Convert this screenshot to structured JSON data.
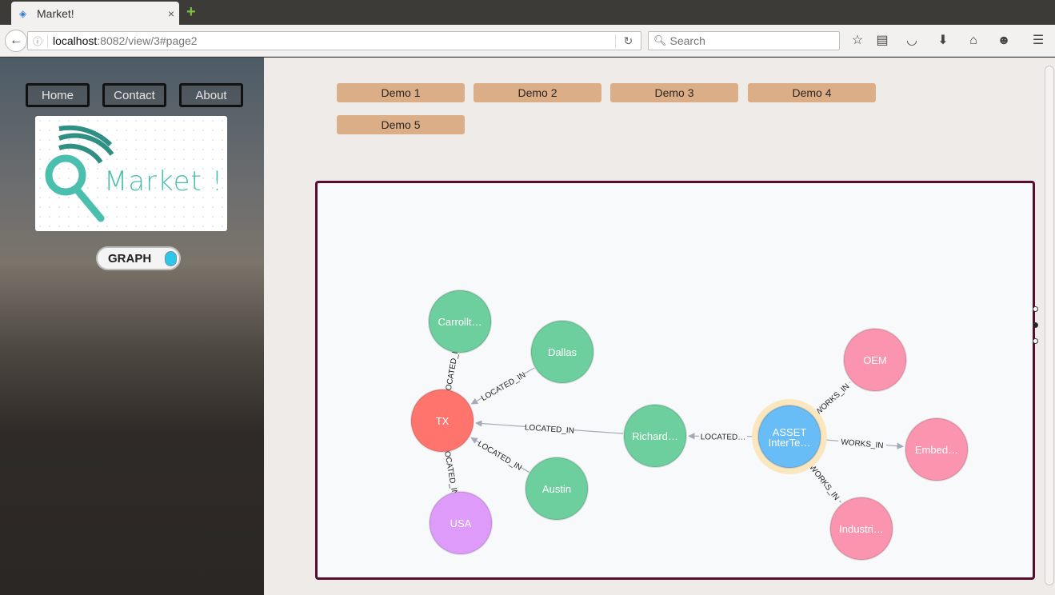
{
  "browser": {
    "tab_title": "Market!",
    "tab_close": "×",
    "new_tab": "+",
    "url_host": "localhost",
    "url_rest": ":8082/view/3#page2",
    "search_placeholder": "Search"
  },
  "sidebar": {
    "nav": [
      {
        "label": "Home"
      },
      {
        "label": "Contact"
      },
      {
        "label": "About"
      }
    ],
    "logo_text": "Market !",
    "toggle_label": "GRAPH"
  },
  "demos": [
    {
      "label": "Demo 1"
    },
    {
      "label": "Demo 2"
    },
    {
      "label": "Demo 3"
    },
    {
      "label": "Demo 4"
    },
    {
      "label": "Demo 5"
    }
  ],
  "graph": {
    "colors": {
      "city": "#6dce9e",
      "state": "#ff756e",
      "country": "#de9bf9",
      "company": "#68bdf6",
      "industry": "#fb95af",
      "selected_ring": "#fae7c0"
    },
    "nodes": [
      {
        "id": "carrollton",
        "label": "Carrollt…",
        "kind": "city"
      },
      {
        "id": "dallas",
        "label": "Dallas",
        "kind": "city"
      },
      {
        "id": "tx",
        "label": "TX",
        "kind": "state"
      },
      {
        "id": "austin",
        "label": "Austin",
        "kind": "city"
      },
      {
        "id": "usa",
        "label": "USA",
        "kind": "country"
      },
      {
        "id": "richardson",
        "label": "Richard…",
        "kind": "city"
      },
      {
        "id": "asset",
        "label": "ASSET",
        "label2": "InterTe…",
        "kind": "company"
      },
      {
        "id": "oem",
        "label": "OEM",
        "kind": "industry"
      },
      {
        "id": "embedded",
        "label": "Embed…",
        "kind": "industry"
      },
      {
        "id": "industrial",
        "label": "Industri…",
        "kind": "industry"
      }
    ],
    "edges": [
      {
        "from": "carrollton",
        "to": "tx",
        "label": "LOCATED_IN"
      },
      {
        "from": "dallas",
        "to": "tx",
        "label": "LOCATED_IN"
      },
      {
        "from": "richardson",
        "to": "tx",
        "label": "LOCATED_IN"
      },
      {
        "from": "austin",
        "to": "tx",
        "label": "LOCATED_IN"
      },
      {
        "from": "tx",
        "to": "usa",
        "label": "LOCATED_IN"
      },
      {
        "from": "asset",
        "to": "richardson",
        "label": "LOCATED…"
      },
      {
        "from": "asset",
        "to": "oem",
        "label": "WORKS_IN"
      },
      {
        "from": "asset",
        "to": "embedded",
        "label": "WORKS_IN"
      },
      {
        "from": "asset",
        "to": "industrial",
        "label": "WORKS_IN"
      }
    ]
  }
}
